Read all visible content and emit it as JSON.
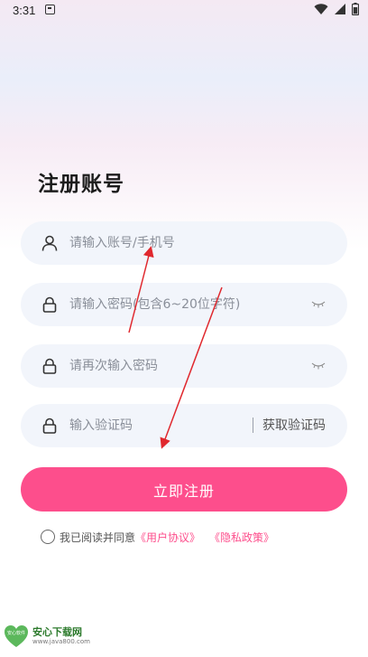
{
  "status_bar": {
    "time": "3:31"
  },
  "page": {
    "title": "注册账号"
  },
  "form": {
    "account_placeholder": "请输入账号/手机号",
    "password_placeholder": "请输入密码(包含6~20位字符)",
    "confirm_placeholder": "请再次输入密码",
    "code_placeholder": "输入验证码",
    "get_code_label": "获取验证码",
    "submit_label": "立即注册"
  },
  "agreement": {
    "prefix": "我已阅读并同意",
    "user_agreement": "《用户协议》",
    "privacy_policy": "《隐私政策》"
  },
  "watermark": {
    "logo_text": "安心软件",
    "title": "安心下载网",
    "url": "www.java800.com"
  },
  "colors": {
    "accent": "#fd4e8c",
    "field_bg": "#f2f5fb",
    "arrow": "#e0282e"
  }
}
